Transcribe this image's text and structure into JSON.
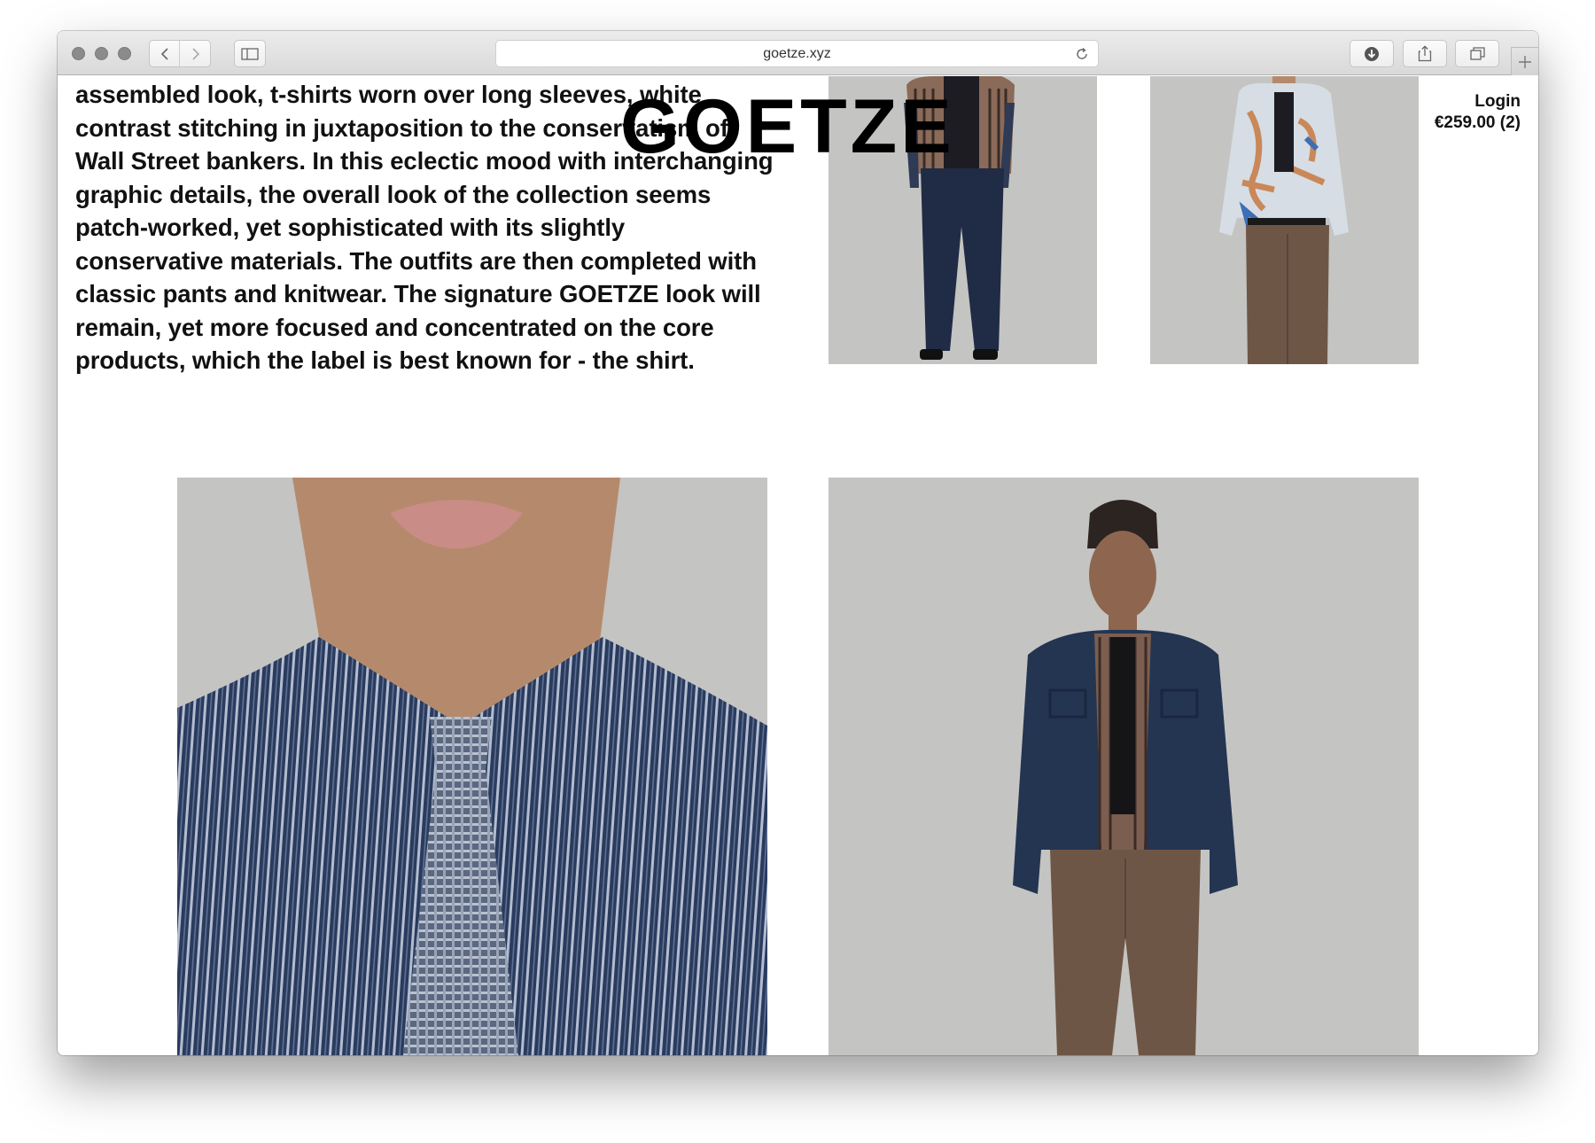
{
  "browser": {
    "url": "goetze.xyz"
  },
  "site": {
    "logo": "GOETZE",
    "login_label": "Login",
    "cart_label": "€259.00 (2)",
    "intro_text": "assembled look, t-shirts worn over long sleeves, white contrast stitching in juxtaposition to the conservatism of Wall Street bankers. In this eclectic mood with interchanging graphic details, the overall look of the collection seems patch-worked, yet sophisticated with its slightly conservative materials. The outfits are then completed with classic pants and knitwear. The signature GOETZE look will remain, yet more focused and concentrated on the core products, which the label is best known for - the shirt."
  },
  "colors": {
    "photo_background": "#c4c4c2",
    "navy_fabric": "#243552",
    "brown_fabric": "#6e5646",
    "skin": "#b58a6c"
  },
  "icons": [
    "back-arrow-icon",
    "forward-arrow-icon",
    "sidebar-icon",
    "reload-icon",
    "download-icon",
    "share-icon",
    "tabs-icon",
    "new-tab-plus-icon"
  ]
}
